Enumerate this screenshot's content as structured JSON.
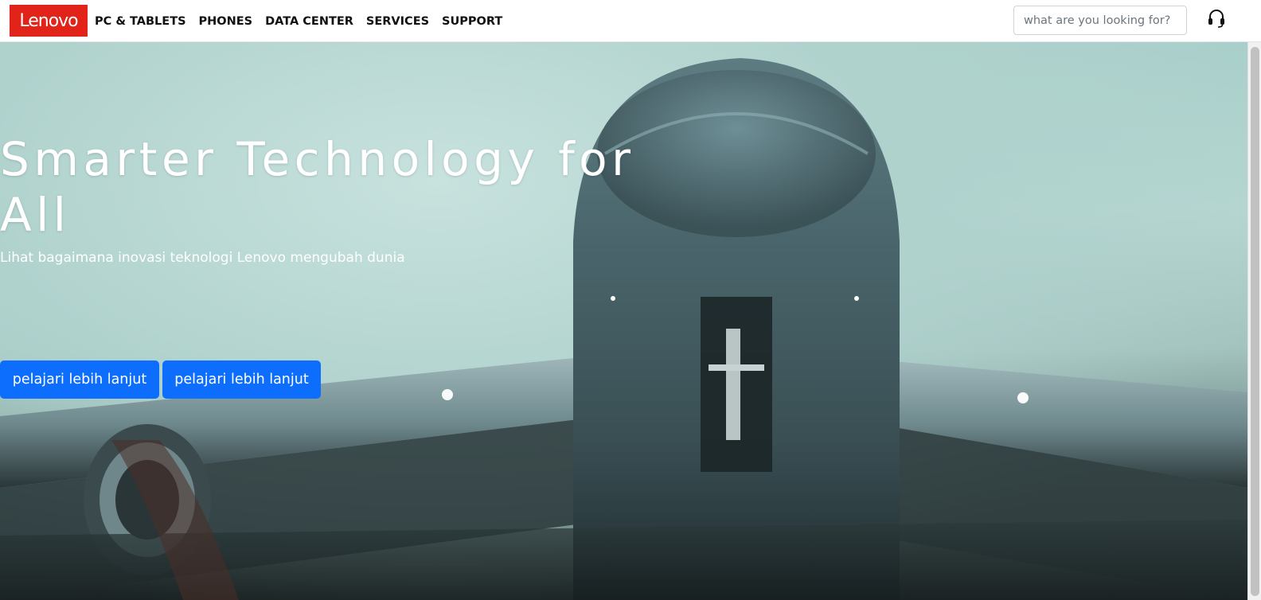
{
  "brand": {
    "logo_text": "Lenovo",
    "logo_color": "#e2231a"
  },
  "nav": {
    "items": [
      {
        "label": "PC & TABLETS"
      },
      {
        "label": "PHONES"
      },
      {
        "label": "DATA CENTER"
      },
      {
        "label": "SERVICES"
      },
      {
        "label": "SUPPORT"
      }
    ]
  },
  "search": {
    "placeholder": "what are you looking for?",
    "value": ""
  },
  "header_icons": {
    "support": "headset-icon"
  },
  "hero": {
    "title": "Smarter Technology for All",
    "subtitle": "Lihat bagaimana inovasi teknologi Lenovo mengubah dunia",
    "buttons": [
      {
        "label": "pelajari lebih lanjut"
      },
      {
        "label": "pelajari lebih lanjut"
      }
    ],
    "button_color": "#0d6efd"
  }
}
